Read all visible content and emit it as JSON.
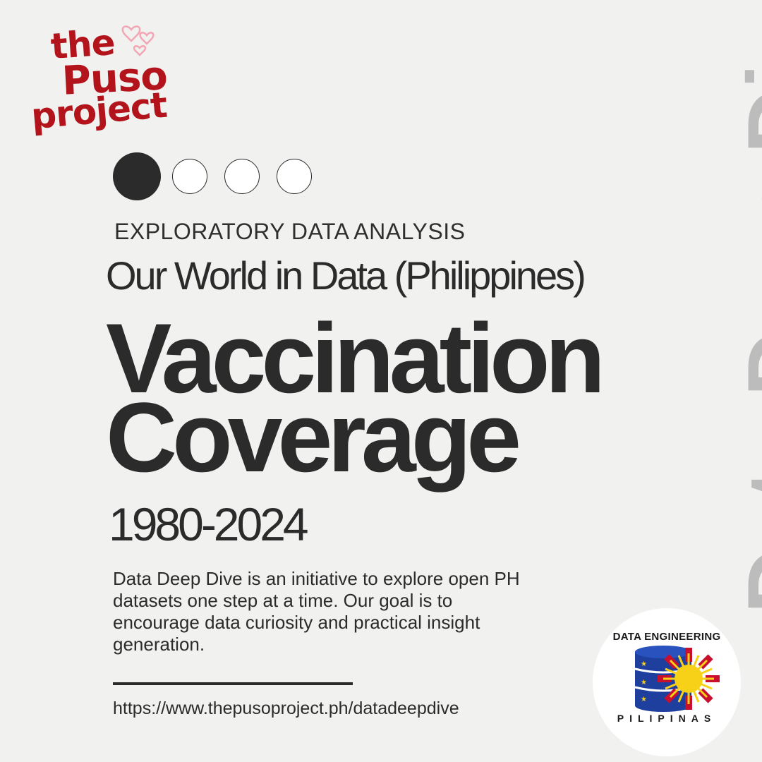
{
  "logo": {
    "line1": "the",
    "line2": "Puso",
    "line3": "project"
  },
  "pagination": {
    "total": 4,
    "active_index": 0
  },
  "subheading": "EXPLORATORY DATA ANALYSIS",
  "source": "Our World in Data (Philippines)",
  "title": {
    "line1": "Vaccination",
    "line2": "Coverage"
  },
  "years": "1980-2024",
  "description": "Data Deep Dive is an initiative to explore open PH datasets one step at a time. Our goal is to encourage data curiosity and practical insight generation.",
  "url": "https://www.thepusoproject.ph/datadeepdive",
  "vertical_title": "Data Deep Dive",
  "badge": {
    "top_text": "DATA ENGINEERING",
    "bottom_text": "PILIPINAS",
    "icon": "database-sun-icon"
  },
  "colors": {
    "background": "#f1f1f0",
    "text": "#2b2b2b",
    "brand_red": "#b3141b",
    "vertical_title": "#bdbcbc",
    "flag_blue": "#1e3f9e",
    "flag_yellow": "#f7d117",
    "flag_red": "#c8102e"
  }
}
